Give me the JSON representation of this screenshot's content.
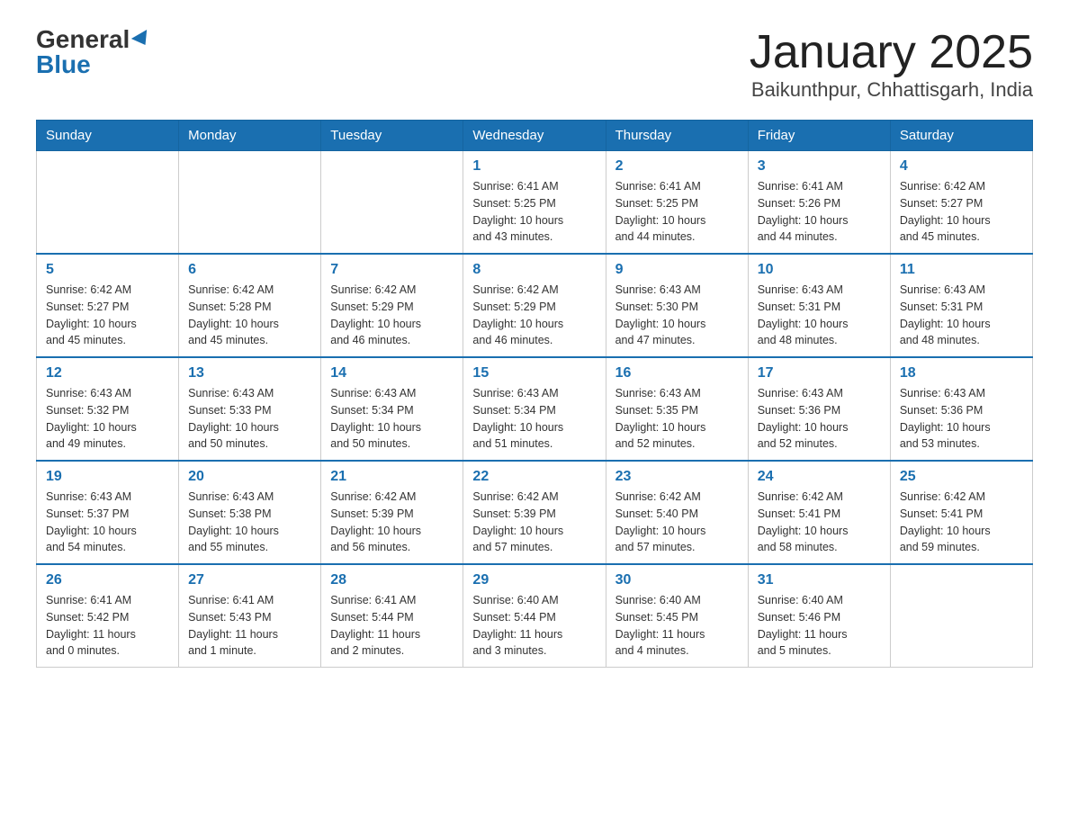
{
  "header": {
    "logo_general": "General",
    "logo_blue": "Blue",
    "title": "January 2025",
    "subtitle": "Baikunthpur, Chhattisgarh, India"
  },
  "weekdays": [
    "Sunday",
    "Monday",
    "Tuesday",
    "Wednesday",
    "Thursday",
    "Friday",
    "Saturday"
  ],
  "weeks": [
    [
      {
        "day": "",
        "info": ""
      },
      {
        "day": "",
        "info": ""
      },
      {
        "day": "",
        "info": ""
      },
      {
        "day": "1",
        "info": "Sunrise: 6:41 AM\nSunset: 5:25 PM\nDaylight: 10 hours\nand 43 minutes."
      },
      {
        "day": "2",
        "info": "Sunrise: 6:41 AM\nSunset: 5:25 PM\nDaylight: 10 hours\nand 44 minutes."
      },
      {
        "day": "3",
        "info": "Sunrise: 6:41 AM\nSunset: 5:26 PM\nDaylight: 10 hours\nand 44 minutes."
      },
      {
        "day": "4",
        "info": "Sunrise: 6:42 AM\nSunset: 5:27 PM\nDaylight: 10 hours\nand 45 minutes."
      }
    ],
    [
      {
        "day": "5",
        "info": "Sunrise: 6:42 AM\nSunset: 5:27 PM\nDaylight: 10 hours\nand 45 minutes."
      },
      {
        "day": "6",
        "info": "Sunrise: 6:42 AM\nSunset: 5:28 PM\nDaylight: 10 hours\nand 45 minutes."
      },
      {
        "day": "7",
        "info": "Sunrise: 6:42 AM\nSunset: 5:29 PM\nDaylight: 10 hours\nand 46 minutes."
      },
      {
        "day": "8",
        "info": "Sunrise: 6:42 AM\nSunset: 5:29 PM\nDaylight: 10 hours\nand 46 minutes."
      },
      {
        "day": "9",
        "info": "Sunrise: 6:43 AM\nSunset: 5:30 PM\nDaylight: 10 hours\nand 47 minutes."
      },
      {
        "day": "10",
        "info": "Sunrise: 6:43 AM\nSunset: 5:31 PM\nDaylight: 10 hours\nand 48 minutes."
      },
      {
        "day": "11",
        "info": "Sunrise: 6:43 AM\nSunset: 5:31 PM\nDaylight: 10 hours\nand 48 minutes."
      }
    ],
    [
      {
        "day": "12",
        "info": "Sunrise: 6:43 AM\nSunset: 5:32 PM\nDaylight: 10 hours\nand 49 minutes."
      },
      {
        "day": "13",
        "info": "Sunrise: 6:43 AM\nSunset: 5:33 PM\nDaylight: 10 hours\nand 50 minutes."
      },
      {
        "day": "14",
        "info": "Sunrise: 6:43 AM\nSunset: 5:34 PM\nDaylight: 10 hours\nand 50 minutes."
      },
      {
        "day": "15",
        "info": "Sunrise: 6:43 AM\nSunset: 5:34 PM\nDaylight: 10 hours\nand 51 minutes."
      },
      {
        "day": "16",
        "info": "Sunrise: 6:43 AM\nSunset: 5:35 PM\nDaylight: 10 hours\nand 52 minutes."
      },
      {
        "day": "17",
        "info": "Sunrise: 6:43 AM\nSunset: 5:36 PM\nDaylight: 10 hours\nand 52 minutes."
      },
      {
        "day": "18",
        "info": "Sunrise: 6:43 AM\nSunset: 5:36 PM\nDaylight: 10 hours\nand 53 minutes."
      }
    ],
    [
      {
        "day": "19",
        "info": "Sunrise: 6:43 AM\nSunset: 5:37 PM\nDaylight: 10 hours\nand 54 minutes."
      },
      {
        "day": "20",
        "info": "Sunrise: 6:43 AM\nSunset: 5:38 PM\nDaylight: 10 hours\nand 55 minutes."
      },
      {
        "day": "21",
        "info": "Sunrise: 6:42 AM\nSunset: 5:39 PM\nDaylight: 10 hours\nand 56 minutes."
      },
      {
        "day": "22",
        "info": "Sunrise: 6:42 AM\nSunset: 5:39 PM\nDaylight: 10 hours\nand 57 minutes."
      },
      {
        "day": "23",
        "info": "Sunrise: 6:42 AM\nSunset: 5:40 PM\nDaylight: 10 hours\nand 57 minutes."
      },
      {
        "day": "24",
        "info": "Sunrise: 6:42 AM\nSunset: 5:41 PM\nDaylight: 10 hours\nand 58 minutes."
      },
      {
        "day": "25",
        "info": "Sunrise: 6:42 AM\nSunset: 5:41 PM\nDaylight: 10 hours\nand 59 minutes."
      }
    ],
    [
      {
        "day": "26",
        "info": "Sunrise: 6:41 AM\nSunset: 5:42 PM\nDaylight: 11 hours\nand 0 minutes."
      },
      {
        "day": "27",
        "info": "Sunrise: 6:41 AM\nSunset: 5:43 PM\nDaylight: 11 hours\nand 1 minute."
      },
      {
        "day": "28",
        "info": "Sunrise: 6:41 AM\nSunset: 5:44 PM\nDaylight: 11 hours\nand 2 minutes."
      },
      {
        "day": "29",
        "info": "Sunrise: 6:40 AM\nSunset: 5:44 PM\nDaylight: 11 hours\nand 3 minutes."
      },
      {
        "day": "30",
        "info": "Sunrise: 6:40 AM\nSunset: 5:45 PM\nDaylight: 11 hours\nand 4 minutes."
      },
      {
        "day": "31",
        "info": "Sunrise: 6:40 AM\nSunset: 5:46 PM\nDaylight: 11 hours\nand 5 minutes."
      },
      {
        "day": "",
        "info": ""
      }
    ]
  ]
}
